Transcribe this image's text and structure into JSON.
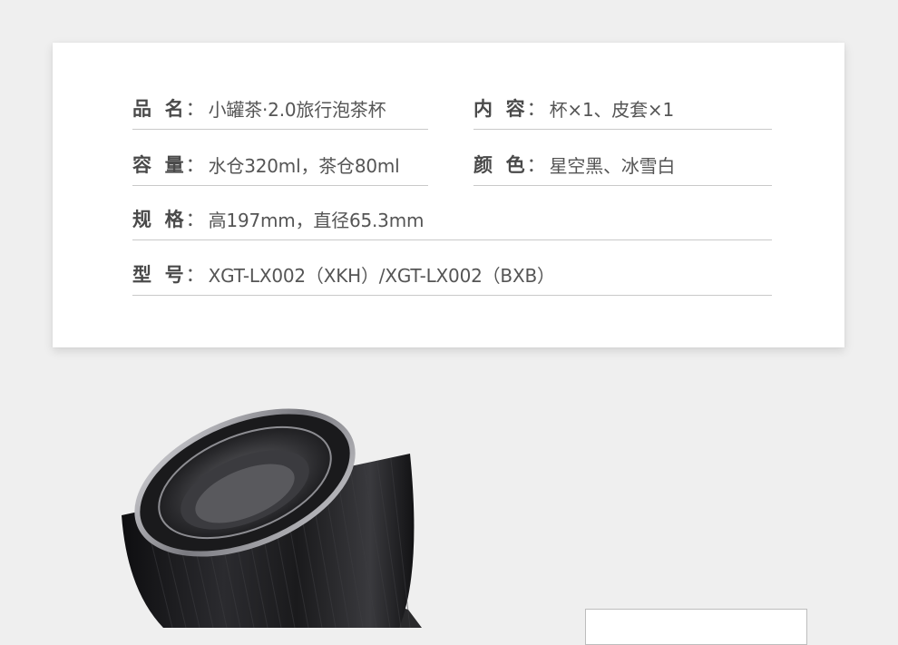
{
  "specs": {
    "name": {
      "label": "品  名",
      "value": "小罐茶·2.0旅行泡茶杯"
    },
    "contents": {
      "label": "内  容",
      "value": "杯×1、皮套×1"
    },
    "capacity": {
      "label": "容  量",
      "value": "水仓320ml，茶仓80ml"
    },
    "colors": {
      "label": "颜  色",
      "value": "星空黑、冰雪白"
    },
    "size": {
      "label": "规  格",
      "value": "高197mm，直径65.3mm"
    },
    "model": {
      "label": "型  号",
      "value": "XGT-LX002（XKH）/XGT-LX002（BXB）"
    }
  },
  "colon": "：",
  "colors": {
    "background": "#efefef",
    "card": "#ffffff",
    "label_text": "#4a4a4a",
    "value_text": "#555555",
    "divider": "#c9c9c9",
    "product_body": "#1c1c1e",
    "product_rim": "#b8b8bc"
  }
}
